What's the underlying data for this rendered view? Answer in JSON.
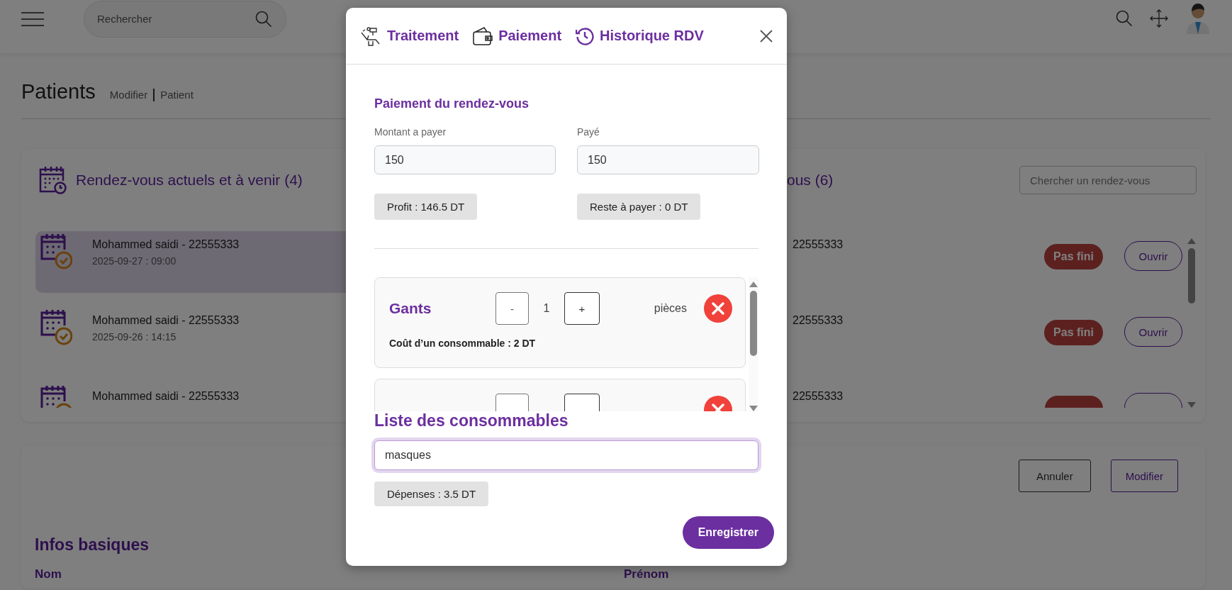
{
  "topbar": {
    "search": {
      "placeholder": "Rechercher"
    }
  },
  "page": {
    "title": "Patients",
    "breadcrumb": [
      "Modifier",
      "Patient"
    ]
  },
  "current_appointments": {
    "title": "Rendez-vous actuels et à venir (4)",
    "items": [
      {
        "name": "Mohammed saidi - 22555333",
        "datetime": "2025-09-27 : 09:00",
        "selected": true
      },
      {
        "name": "Mohammed saidi - 22555333",
        "datetime": "2025-09-26 : 14:15",
        "selected": false
      },
      {
        "name": "Mohammed saidi - 22555333",
        "selected": false
      }
    ]
  },
  "past_appointments": {
    "title": "ous (6)",
    "search": {
      "placeholder": "Chercher un rendez-vous"
    },
    "items": [
      {
        "phone": "22555333",
        "status": "Pas fini",
        "action": "Ouvrir"
      },
      {
        "phone": "22555333",
        "status": "Pas fini",
        "action": "Ouvrir"
      },
      {
        "phone": "22555333"
      }
    ]
  },
  "patient_form": {
    "buttons": [
      "Annuler",
      "Modifier"
    ],
    "section_title": "Infos basiques",
    "fields": [
      {
        "label": "Nom"
      },
      {
        "label": "Prénom"
      }
    ]
  },
  "modal": {
    "tabs": [
      {
        "label": "Traitement"
      },
      {
        "label": "Paiement"
      },
      {
        "label": "Historique RDV"
      }
    ],
    "payment": {
      "title": "Paiement du rendez-vous",
      "fields": [
        {
          "label": "Montant a payer",
          "value": "150"
        },
        {
          "label": "Payé",
          "value": "150"
        }
      ],
      "summaries": [
        "Profit : 146.5 DT",
        "Reste à payer : 0 DT"
      ]
    },
    "consumables": {
      "items": [
        {
          "kind": "full",
          "name": "Gants",
          "decrement": "-",
          "quantity": "1",
          "increment": "+",
          "unit": "pièces",
          "unit_cost": "Coût d’un consommable : 2 DT"
        },
        {
          "kind": "partial"
        }
      ],
      "title": "Liste des consommables",
      "search": {
        "value": "masques"
      },
      "expenses": "Dépenses : 3.5 DT"
    },
    "save_button": "Enregistrer"
  }
}
